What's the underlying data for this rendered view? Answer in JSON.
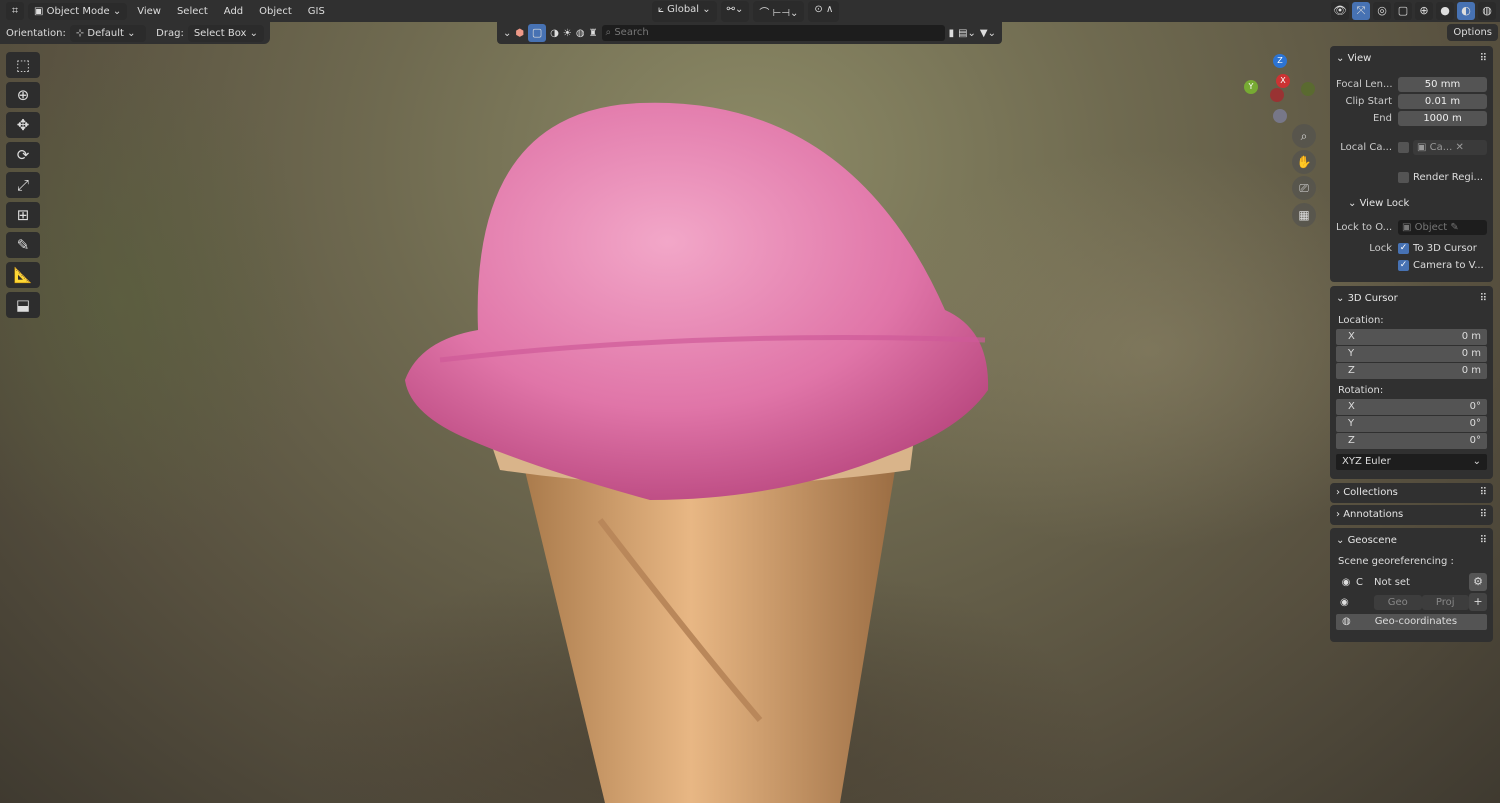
{
  "header": {
    "mode": "Object Mode",
    "menus": [
      "View",
      "Select",
      "Add",
      "Object",
      "GIS"
    ],
    "orientation_label": "Orientation:",
    "orientation": "Default",
    "drag_label": "Drag:",
    "drag": "Select Box",
    "transform": "Global",
    "search_placeholder": "Search",
    "options": "Options"
  },
  "view_panel": {
    "title": "View",
    "focal_label": "Focal Len...",
    "focal": "50 mm",
    "clip_start_label": "Clip Start",
    "clip_start": "0.01 m",
    "end_label": "End",
    "end": "1000 m",
    "local_cam_label": "Local Ca...",
    "local_cam": "Ca...",
    "render_region": "Render Regi...",
    "view_lock": "View Lock",
    "lock_to_label": "Lock to O...",
    "lock_to_placeholder": "Object",
    "lock_label": "Lock",
    "to_3d_cursor": "To 3D Cursor",
    "camera_to_view": "Camera to V..."
  },
  "cursor_panel": {
    "title": "3D Cursor",
    "location": "Location:",
    "loc": [
      {
        "axis": "X",
        "value": "0 m"
      },
      {
        "axis": "Y",
        "value": "0 m"
      },
      {
        "axis": "Z",
        "value": "0 m"
      }
    ],
    "rotation": "Rotation:",
    "rot": [
      {
        "axis": "X",
        "value": "0°"
      },
      {
        "axis": "Y",
        "value": "0°"
      },
      {
        "axis": "Z",
        "value": "0°"
      }
    ],
    "mode": "XYZ Euler"
  },
  "collections": "Collections",
  "annotations": "Annotations",
  "geoscene": {
    "title": "Geoscene",
    "label": "Scene georeferencing :",
    "crs_prefix": "C",
    "crs": "Not set",
    "geo": "Geo",
    "proj": "Proj",
    "geo_coords": "Geo-coordinates"
  },
  "gizmo": {
    "z": "Z",
    "y": "Y",
    "x": "X"
  }
}
